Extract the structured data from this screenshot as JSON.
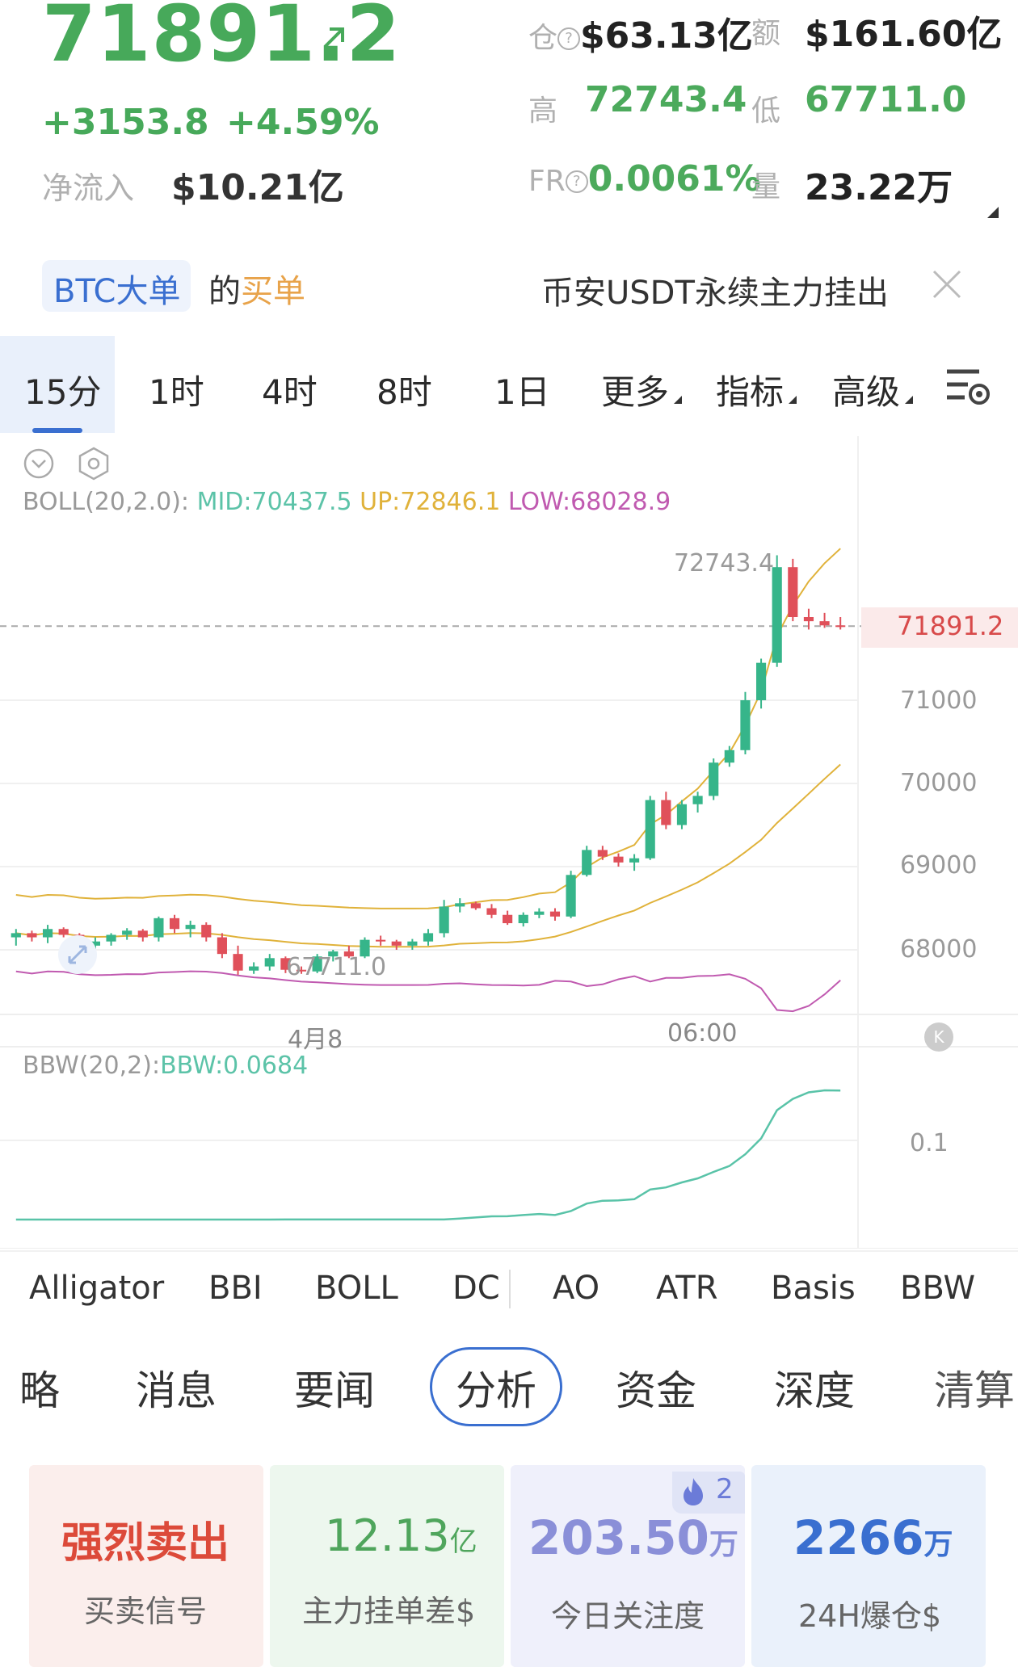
{
  "header": {
    "price": "71891.2",
    "change": "+3153.8",
    "change_pct": "+4.59%",
    "net_inflow_label": "净流入",
    "net_inflow_value": "$10.21亿",
    "oi_label": "仓",
    "oi_value": "$63.13亿",
    "amount_label": "额",
    "amount_value": "$161.60亿",
    "high_label": "高",
    "high_value": "72743.4",
    "low_label": "低",
    "low_value": "67711.0",
    "fr_label": "FR",
    "fr_value": "0.0061%",
    "volume_label": "量",
    "volume_value": "23.22万"
  },
  "banner": {
    "tag": "BTC大单",
    "text_prefix": "的",
    "text_highlight": "买单",
    "right_text": "币安USDT永续主力挂出"
  },
  "timeframes": [
    "15分",
    "1时",
    "4时",
    "8时",
    "1日",
    "更多",
    "指标",
    "高级"
  ],
  "chart": {
    "boll_label": "BOLL(20,2.0):",
    "boll_mid": "MID:70437.5",
    "boll_up": "UP:72846.1",
    "boll_low": "LOW:68028.9",
    "high_marker": "72743.4",
    "low_marker": "67711.0",
    "current_price_tag": "71891.2",
    "x_labels": [
      "4月8",
      "06:00"
    ],
    "y_labels": [
      "71000",
      "70000",
      "69000",
      "68000"
    ],
    "bbw_label": "BBW(20,2):",
    "bbw_value": "BBW:0.0684",
    "bbw_y_label": "0.1",
    "colors": {
      "up": "#36b58a",
      "down": "#e0505a",
      "mid": "#e0b23a",
      "upper": "#e0b23a",
      "lower": "#c05ab0",
      "bbw": "#59c3a8"
    }
  },
  "chart_data": {
    "type": "candlestick",
    "title": "",
    "ylim": [
      67500,
      73000
    ],
    "x_labels": [
      "4月8",
      "06:00"
    ],
    "y_ticks": [
      68000,
      69000,
      70000,
      71000
    ],
    "candles_ohlc": [
      [
        68150,
        68250,
        68050,
        68200
      ],
      [
        68200,
        68230,
        68100,
        68150
      ],
      [
        68150,
        68300,
        68080,
        68250
      ],
      [
        68250,
        68270,
        68150,
        68180
      ],
      [
        68180,
        68200,
        68000,
        68050
      ],
      [
        68050,
        68150,
        67950,
        68100
      ],
      [
        68100,
        68200,
        68050,
        68180
      ],
      [
        68180,
        68260,
        68120,
        68230
      ],
      [
        68230,
        68250,
        68100,
        68150
      ],
      [
        68150,
        68400,
        68100,
        68380
      ],
      [
        68380,
        68420,
        68200,
        68250
      ],
      [
        68250,
        68350,
        68150,
        68300
      ],
      [
        68300,
        68330,
        68100,
        68150
      ],
      [
        68150,
        68200,
        67900,
        67950
      ],
      [
        67950,
        68050,
        67700,
        67750
      ],
      [
        67750,
        67850,
        67711,
        67800
      ],
      [
        67800,
        67950,
        67750,
        67900
      ],
      [
        67900,
        67920,
        67720,
        67760
      ],
      [
        67760,
        67800,
        67711,
        67740
      ],
      [
        67740,
        67950,
        67720,
        67920
      ],
      [
        67920,
        68000,
        67860,
        67980
      ],
      [
        67980,
        68050,
        67900,
        67920
      ],
      [
        67920,
        68150,
        67900,
        68120
      ],
      [
        68120,
        68170,
        68050,
        68100
      ],
      [
        68100,
        68120,
        68000,
        68050
      ],
      [
        68050,
        68130,
        68000,
        68100
      ],
      [
        68100,
        68250,
        68050,
        68200
      ],
      [
        68200,
        68600,
        68150,
        68520
      ],
      [
        68520,
        68620,
        68450,
        68560
      ],
      [
        68560,
        68580,
        68480,
        68500
      ],
      [
        68500,
        68550,
        68380,
        68420
      ],
      [
        68420,
        68470,
        68300,
        68320
      ],
      [
        68320,
        68450,
        68280,
        68420
      ],
      [
        68420,
        68500,
        68380,
        68460
      ],
      [
        68460,
        68500,
        68350,
        68400
      ],
      [
        68400,
        68950,
        68380,
        68900
      ],
      [
        68900,
        69250,
        68880,
        69200
      ],
      [
        69200,
        69250,
        69080,
        69120
      ],
      [
        69120,
        69160,
        69000,
        69050
      ],
      [
        69050,
        69150,
        68950,
        69100
      ],
      [
        69100,
        69850,
        69080,
        69800
      ],
      [
        69800,
        69900,
        69450,
        69500
      ],
      [
        69500,
        69800,
        69450,
        69750
      ],
      [
        69750,
        69900,
        69650,
        69850
      ],
      [
        69850,
        70300,
        69800,
        70250
      ],
      [
        70250,
        70450,
        70200,
        70400
      ],
      [
        70400,
        71100,
        70350,
        71000
      ],
      [
        71000,
        71500,
        70900,
        71450
      ],
      [
        71450,
        72743,
        71400,
        72600
      ],
      [
        72600,
        72700,
        71950,
        72000
      ],
      [
        72000,
        72100,
        71850,
        71950
      ],
      [
        71950,
        72050,
        71870,
        71900
      ],
      [
        71900,
        72000,
        71850,
        71891
      ]
    ],
    "boll_mid": 70437.5,
    "boll_up": 72846.1,
    "boll_low": 68028.9,
    "bbw": 0.0684
  },
  "indicators": [
    "Alligator",
    "BBI",
    "BOLL",
    "DC",
    "AO",
    "ATR",
    "Basis",
    "BBW"
  ],
  "tabs": [
    "略",
    "消息",
    "要闻",
    "分析",
    "资金",
    "深度",
    "清算"
  ],
  "cards": [
    {
      "value": "强烈卖出",
      "label": "买卖信号"
    },
    {
      "value": "12.13",
      "unit": "亿",
      "label": "主力挂单差$"
    },
    {
      "value": "203.50",
      "unit": "万",
      "label": "今日关注度",
      "badge": "2"
    },
    {
      "value": "2266",
      "unit": "万",
      "label": "24H爆仓$"
    }
  ]
}
